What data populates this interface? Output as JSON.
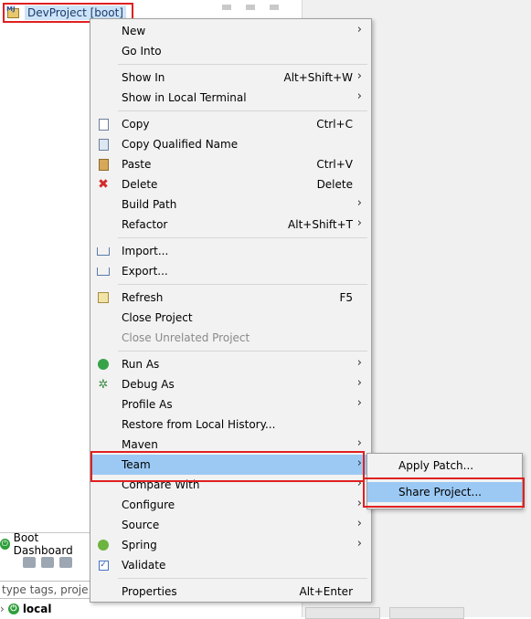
{
  "project": {
    "label": "DevProject [boot]"
  },
  "boot_dashboard": {
    "tab_label": "Boot Dashboard",
    "filter_placeholder": "type tags, projects,",
    "local_label": "local"
  },
  "menu": {
    "items": [
      {
        "label": "New",
        "accel": "",
        "submenu": true,
        "icon": ""
      },
      {
        "label": "Go Into",
        "accel": "",
        "submenu": false,
        "icon": ""
      },
      {
        "label": "Show In",
        "accel": "Alt+Shift+W",
        "submenu": true,
        "icon": ""
      },
      {
        "label": "Show in Local Terminal",
        "accel": "",
        "submenu": true,
        "icon": ""
      },
      {
        "label": "Copy",
        "accel": "Ctrl+C",
        "submenu": false,
        "icon": "copy-icon"
      },
      {
        "label": "Copy Qualified Name",
        "accel": "",
        "submenu": false,
        "icon": "copy-qualified-icon"
      },
      {
        "label": "Paste",
        "accel": "Ctrl+V",
        "submenu": false,
        "icon": "paste-icon"
      },
      {
        "label": "Delete",
        "accel": "Delete",
        "submenu": false,
        "icon": "delete-icon"
      },
      {
        "label": "Build Path",
        "accel": "",
        "submenu": true,
        "icon": ""
      },
      {
        "label": "Refactor",
        "accel": "Alt+Shift+T",
        "submenu": true,
        "icon": ""
      },
      {
        "label": "Import...",
        "accel": "",
        "submenu": false,
        "icon": "import-icon"
      },
      {
        "label": "Export...",
        "accel": "",
        "submenu": false,
        "icon": "export-icon"
      },
      {
        "label": "Refresh",
        "accel": "F5",
        "submenu": false,
        "icon": "refresh-icon"
      },
      {
        "label": "Close Project",
        "accel": "",
        "submenu": false,
        "icon": ""
      },
      {
        "label": "Close Unrelated Project",
        "accel": "",
        "submenu": false,
        "icon": "",
        "disabled": true
      },
      {
        "label": "Run As",
        "accel": "",
        "submenu": true,
        "icon": "run-icon"
      },
      {
        "label": "Debug As",
        "accel": "",
        "submenu": true,
        "icon": "debug-icon"
      },
      {
        "label": "Profile As",
        "accel": "",
        "submenu": true,
        "icon": ""
      },
      {
        "label": "Restore from Local History...",
        "accel": "",
        "submenu": false,
        "icon": ""
      },
      {
        "label": "Maven",
        "accel": "",
        "submenu": true,
        "icon": ""
      },
      {
        "label": "Team",
        "accel": "",
        "submenu": true,
        "icon": "",
        "highlighted": true
      },
      {
        "label": "Compare With",
        "accel": "",
        "submenu": true,
        "icon": ""
      },
      {
        "label": "Configure",
        "accel": "",
        "submenu": true,
        "icon": ""
      },
      {
        "label": "Source",
        "accel": "",
        "submenu": true,
        "icon": ""
      },
      {
        "label": "Spring",
        "accel": "",
        "submenu": true,
        "icon": "spring-icon"
      },
      {
        "label": "Validate",
        "accel": "",
        "submenu": false,
        "icon": "validate-check-icon"
      },
      {
        "label": "Properties",
        "accel": "Alt+Enter",
        "submenu": false,
        "icon": ""
      }
    ]
  },
  "team_submenu": {
    "items": [
      {
        "label": "Apply Patch..."
      },
      {
        "label": "Share Project...",
        "highlighted": true
      }
    ]
  }
}
